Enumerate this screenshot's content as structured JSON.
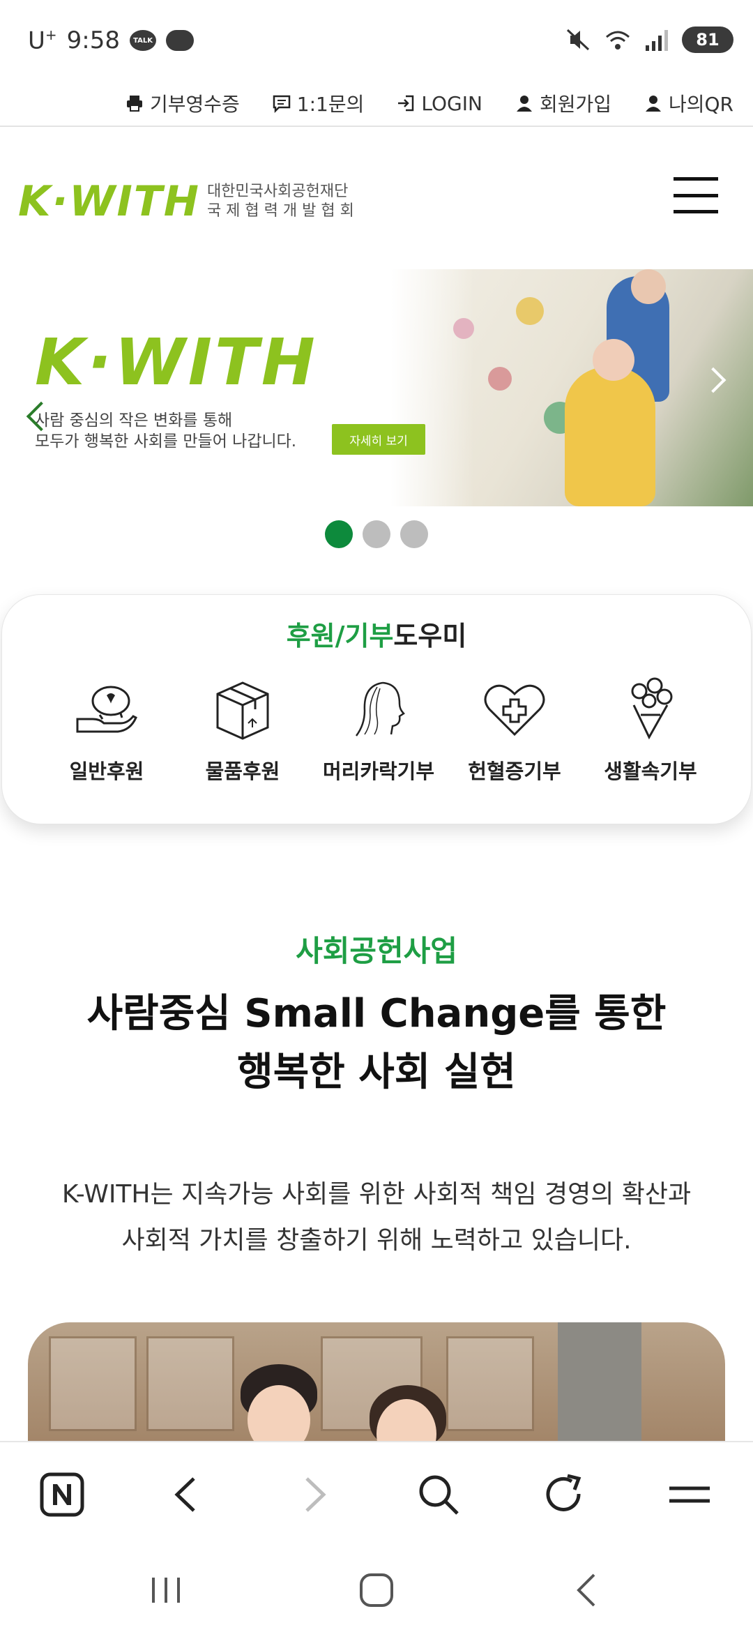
{
  "status_bar": {
    "carrier": "U",
    "carrier_sup": "+",
    "time": "9:58",
    "talk_label": "TALK",
    "battery": "81",
    "icons": [
      "kakaotalk-icon",
      "cloud-chat-icon",
      "mute-icon",
      "wifi-icon",
      "signal-icon",
      "battery-icon"
    ]
  },
  "util_links": [
    {
      "label": "기부영수증",
      "icon": "printer-icon"
    },
    {
      "label": "1:1문의",
      "icon": "message-icon"
    },
    {
      "label": "LOGIN",
      "icon": "login-icon"
    },
    {
      "label": "회원가입",
      "icon": "user-icon"
    },
    {
      "label": "나의QR",
      "icon": "user-icon"
    }
  ],
  "header": {
    "logo_mark": "K·WITH",
    "logo_line1": "대한민국사회공헌재단",
    "logo_line2": "국 제 협 력 개 발 협 회"
  },
  "hero": {
    "logo": "K·WITH",
    "desc_line1": "사람 중심의 작은 변화를 통해",
    "desc_line2": "모두가 행복한 사회를 만들어 나갑니다.",
    "button": "자세히 보기",
    "slide_count": 3,
    "active_slide": 1
  },
  "help": {
    "title_green": "후원/기부",
    "title_black": "도우미",
    "items": [
      {
        "label": "일반후원",
        "icon": "piggy-bank-hand-icon"
      },
      {
        "label": "물품후원",
        "icon": "box-icon"
      },
      {
        "label": "머리카락기부",
        "icon": "hair-profile-icon"
      },
      {
        "label": "헌혈증기부",
        "icon": "heart-cross-icon"
      },
      {
        "label": "생활속기부",
        "icon": "flower-bouquet-icon"
      }
    ]
  },
  "section": {
    "kicker": "사회공헌사업",
    "title_line1": "사람중심 Small Change를 통한",
    "title_line2": "행복한 사회 실현",
    "desc_line1": "K-WITH는 지속가능 사회를 위한 사회적 책임 경영의 확산과",
    "desc_line2": "사회적 가치를 창출하기 위해 노력하고 있습니다."
  },
  "colors": {
    "brand_green": "#8dc21f",
    "accent_green": "#1e9e44",
    "dot_active": "#0d8a3c"
  }
}
